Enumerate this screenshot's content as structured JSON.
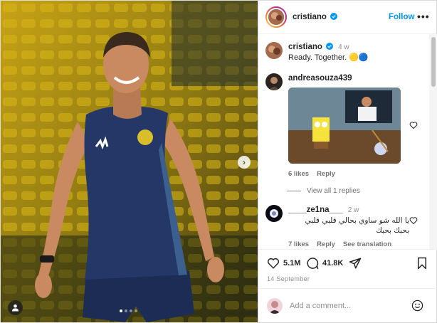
{
  "header": {
    "username": "cristiano",
    "follow_label": "Follow",
    "more_label": "•••"
  },
  "caption": {
    "username": "cristiano",
    "time": "4 w",
    "text": "Ready. Together. 🟡🔵"
  },
  "comments": [
    {
      "username": "andreasouza439",
      "likes": "6 likes",
      "reply": "Reply",
      "view_replies": "View all 1 replies"
    },
    {
      "username": "____ze1na___",
      "time": "2 w",
      "text": "يا الله شو ساوي بحالي قلبي قلبي بحبك بحبك",
      "likes": "7 likes",
      "reply": "Reply",
      "see_translation": "See translation"
    }
  ],
  "actions": {
    "likes_count": "5.1M",
    "comments_count": "41.8K",
    "date": "14 September"
  },
  "add_comment": {
    "placeholder": "Add a comment..."
  },
  "media": {
    "current_slide": 1,
    "total_slides": 4
  }
}
